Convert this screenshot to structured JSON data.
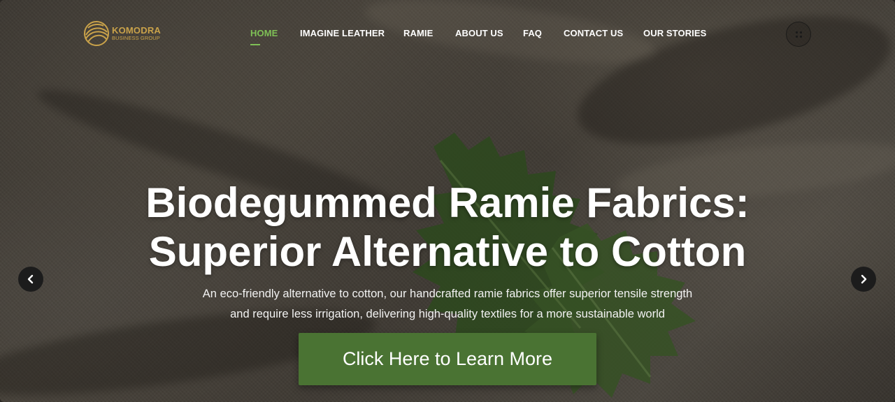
{
  "brand": {
    "name": "KOMODRA",
    "subtitle": "BUSINESS GROUP",
    "logo_icon": "golden-sphere-logo",
    "color": "#c9a24a"
  },
  "nav": {
    "items": [
      {
        "label": "HOME",
        "active": true
      },
      {
        "label": "IMAGINE LEATHER",
        "active": false
      },
      {
        "label": "RAMIE",
        "active": false
      },
      {
        "label": "ABOUT US",
        "active": false
      },
      {
        "label": "FAQ",
        "active": false
      },
      {
        "label": "CONTACT US",
        "active": false
      },
      {
        "label": "OUR STORIES",
        "active": false
      }
    ],
    "active_color": "#7fc056",
    "menu_icon": "grid-dots-icon"
  },
  "hero": {
    "title_line1": "Biodegummed Ramie Fabrics:",
    "title_line2": "Superior Alternative to Cotton",
    "subtitle_line1": "An eco-friendly alternative to cotton, our handcrafted ramie fabrics offer superior tensile strength",
    "subtitle_line2": "and require less irrigation, delivering high-quality textiles for a more sustainable world",
    "cta_label": "Click Here to Learn More",
    "cta_color": "#4a7333",
    "prev_icon": "chevron-left-icon",
    "next_icon": "chevron-right-icon"
  }
}
